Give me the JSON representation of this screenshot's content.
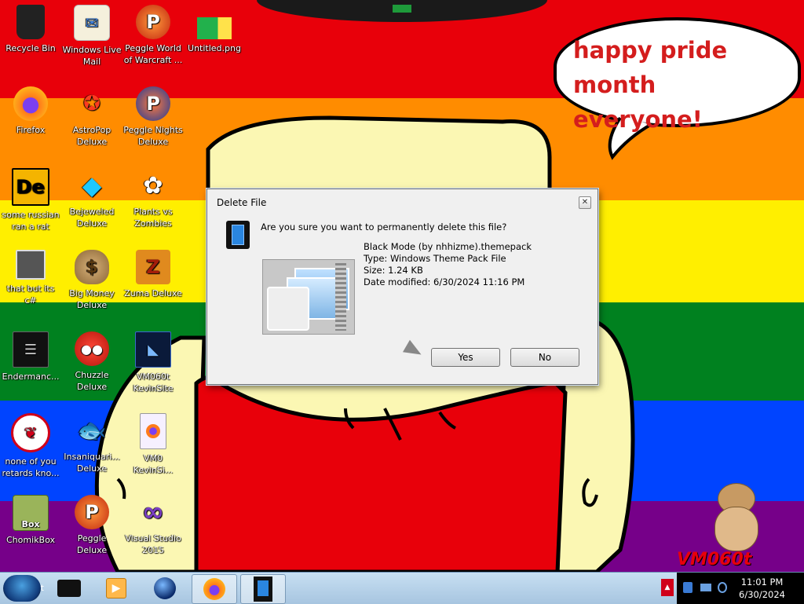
{
  "desktop_icons": [
    {
      "label": "Recycle Bin",
      "icon": "recycle-bin-icon"
    },
    {
      "label": "Windows Live\nMail",
      "icon": "mail-icon"
    },
    {
      "label": "Peggle World\nof Warcraft ...",
      "icon": "peggle-icon"
    },
    {
      "label": "Untitled.png",
      "icon": "image-icon"
    },
    {
      "label": "Firefox",
      "icon": "firefox-icon"
    },
    {
      "label": "AstroPop\nDeluxe",
      "icon": "astropop-icon"
    },
    {
      "label": "Peggle Nights\nDeluxe",
      "icon": "peggle-nights-icon"
    },
    {
      "label": "some russian\nran a rat",
      "icon": "de-icon"
    },
    {
      "label": "Bejeweled\nDeluxe",
      "icon": "gem-icon"
    },
    {
      "label": "Plants vs\nZombies",
      "icon": "plant-icon"
    },
    {
      "label": "that but its c#",
      "icon": "stack-icon"
    },
    {
      "label": "Big Money\nDeluxe",
      "icon": "money-bag-icon"
    },
    {
      "label": "Zuma Deluxe",
      "icon": "zuma-icon"
    },
    {
      "label": "Endermanc...",
      "icon": "terminal-icon"
    },
    {
      "label": "Chuzzle\nDeluxe",
      "icon": "chuzzle-icon"
    },
    {
      "label": "VM060t\nKevinSite",
      "icon": "vm-site-icon"
    },
    {
      "label": "none of you\nretards kno...",
      "icon": "red-dragon-icon"
    },
    {
      "label": "Insaniquari...\nDeluxe",
      "icon": "fish-icon"
    },
    {
      "label": "VM0\nKevinSi...",
      "icon": "firefox-file-icon"
    },
    {
      "label": "ChomikBox",
      "icon": "hamster-box-icon"
    },
    {
      "label": "Peggle Deluxe",
      "icon": "peggle-deluxe-icon"
    },
    {
      "label": "Visual Studio\n2015",
      "icon": "visual-studio-icon"
    }
  ],
  "speech_bubble": {
    "line1": "happy pride month",
    "line2": "everyone!"
  },
  "watermark": "VM060t",
  "dialog": {
    "title": "Delete File",
    "question": "Are you sure you want to permanently delete this file?",
    "file_name": "Black Mode (by nhhizme).themepack",
    "file_type": "Type: Windows Theme Pack File",
    "file_size": "Size: 1.24 KB",
    "file_date": "Date modified: 6/30/2024 11:16 PM",
    "yes_label": "Yes",
    "no_label": "No"
  },
  "taskbar": {
    "time": "11:01 PM",
    "date": "6/30/2024",
    "items": [
      "black-box-icon",
      "media-player-icon",
      "globe-icon",
      "firefox-icon",
      "phone-app-icon"
    ]
  },
  "colors": {
    "stripe_red": "#e8000a",
    "stripe_orange": "#ff8c00",
    "stripe_yellow": "#ffef00",
    "stripe_green": "#00811f",
    "stripe_blue": "#0044ff",
    "stripe_purple": "#760089",
    "bubble_text": "#d41d1d"
  }
}
